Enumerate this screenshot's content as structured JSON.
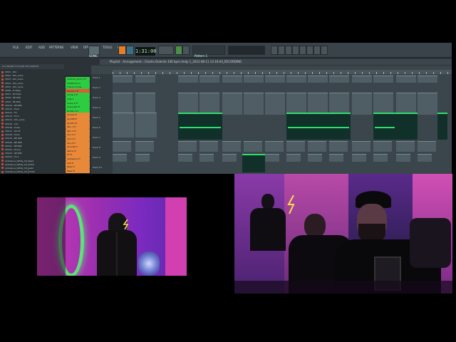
{
  "menu": [
    "FILE",
    "EDIT",
    "ADD",
    "PATTERNS",
    "VIEW",
    "OPTIONS",
    "TOOLS",
    "HELP"
  ],
  "transport": {
    "mode": "SONG",
    "time": "1:31:00",
    "pattern": "Pattern 1"
  },
  "playlist": {
    "title": "Playlist - Arrangement",
    "path": "Charlie Dolente 106 bpm Andy 1_2021-08-11 13-16-04_RECORDING"
  },
  "browser": {
    "tabs": "ALL   PROJECT   PLUGIN DB   SAMPLES",
    "items": [
      "CPU1 - 8ch",
      "CPU2 - 8ch_erms",
      "CPU3 - 8ch_erms",
      "CPU4 - 8ch_erms",
      "CPU5 - 8ch_erms",
      "CPU6 - 8 delay",
      "CPU7 - 8d fade",
      "CPU8 - RE 808",
      "CPU9 - 8E 808",
      "CPU10 - 8E 808",
      "CPU11 - Echo",
      "CPU12 - FX",
      "CPU13 - FX 2",
      "CPU14 - 8ch_erms",
      "CPU15 - mix",
      "CPU16 - Scale",
      "CPU17 - S0 03",
      "CPU18 - Toms",
      "CPU19 - BE 808",
      "CPU20 - BE 808",
      "CPU21 - 8E 808",
      "CPU22 - Drone",
      "CPU23 - 8E 808",
      "CPU24 - FX 1",
      "Ambiance_hifidly_hit_Reqd",
      "Ambiance_hifidly_hit_Snthh",
      "Ambiance_hifidly_hit_Jeetz",
      "Ambiance_hifidly_hit_Echtm",
      "Ambiance_hifidly_hit_Scthh"
    ]
  },
  "rack": [
    {
      "label": "Sidchain_Kick 1 Fl",
      "color": "#2ecc40"
    },
    {
      "label": "CHAIN Kck A",
      "color": "#2ecc40"
    },
    {
      "label": "Fl Kick 2 Cmp",
      "color": "#2ecc40"
    },
    {
      "label": "Drums 1 Fl",
      "color": "#e05a3a"
    },
    {
      "label": "Comp 2 Fl",
      "color": "#2ecc40"
    },
    {
      "label": "Clap 1",
      "color": "#2ecc40"
    },
    {
      "label": "Snare 2 Fl",
      "color": "#2ecc40"
    },
    {
      "label": "Snare Bot Fl",
      "color": "#2ecc40"
    },
    {
      "label": "Hi-Hat 1 Fl",
      "color": "#2ecc40"
    },
    {
      "label": "SynthA Fl",
      "color": "#e8893a"
    },
    {
      "label": "SynthB Fl",
      "color": "#e8893a"
    },
    {
      "label": "SynthC Fl",
      "color": "#e8893a"
    },
    {
      "label": "Perc 1 Fl",
      "color": "#e8893a"
    },
    {
      "label": "Perc 2 Fl",
      "color": "#e8893a"
    },
    {
      "label": "Vox 1 Fl",
      "color": "#e8893a"
    },
    {
      "label": "Vox 2 Fl",
      "color": "#e8893a"
    },
    {
      "label": "Vox 3 Fl",
      "color": "#e8893a"
    },
    {
      "label": "Vox Dbl Fl",
      "color": "#e8893a"
    },
    {
      "label": "Atmos Fl",
      "color": "#e8893a"
    },
    {
      "label": "FX Fl",
      "color": "#e8893a"
    },
    {
      "label": "Ambience Fl",
      "color": "#e8893a"
    },
    {
      "label": "Sub Fl",
      "color": "#e8893a"
    },
    {
      "label": "Bass Fl",
      "color": "#e8893a"
    },
    {
      "label": "Riser Fl",
      "color": "#e8893a"
    }
  ],
  "tracks": [
    "Track 1",
    "Track 2",
    "Track 3",
    "Track 4",
    "Track 5",
    "Track 6",
    "Track 7",
    "Track 8",
    "Track 9",
    "Track 10"
  ],
  "colors": {
    "accent_green": "#2ee06a",
    "neon_pink": "#d63fb5",
    "neon_yellow": "#f2e04a"
  }
}
